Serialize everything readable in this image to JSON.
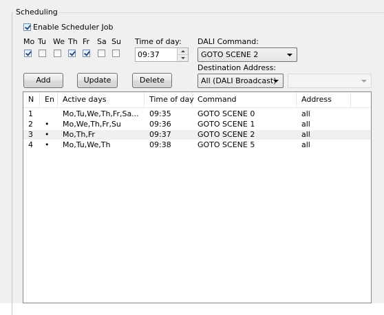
{
  "group": {
    "title": "Scheduling"
  },
  "enable": {
    "label": "Enable Scheduler Job",
    "checked": true
  },
  "days": [
    {
      "label": "Mo",
      "checked": true
    },
    {
      "label": "Tu",
      "checked": false
    },
    {
      "label": "We",
      "checked": false
    },
    {
      "label": "Th",
      "checked": true
    },
    {
      "label": "Fr",
      "checked": true
    },
    {
      "label": "Sa",
      "checked": false
    },
    {
      "label": "Su",
      "checked": false
    }
  ],
  "time_of_day": {
    "label": "Time of day:",
    "value": "09:37"
  },
  "dali_command": {
    "label": "DALI Command:",
    "value": "GOTO SCENE 2"
  },
  "destination": {
    "label": "Destination Address:",
    "value": "All (DALI Broadcast)",
    "secondary_value": ""
  },
  "buttons": {
    "add": "Add",
    "update": "Update",
    "delete": "Delete"
  },
  "table": {
    "columns": [
      "N",
      "En",
      "Active days",
      "Time of day",
      "Command",
      "Address"
    ],
    "selected_row": 2,
    "rows": [
      {
        "n": "1",
        "en": "",
        "days": "Mo,Tu,We,Th,Fr,Sa...",
        "time": "09:35",
        "command": "GOTO SCENE 0",
        "address": "all"
      },
      {
        "n": "2",
        "en": "•",
        "days": "Mo,We,Th,Fr,Su",
        "time": "09:36",
        "command": "GOTO SCENE 1",
        "address": "all"
      },
      {
        "n": "3",
        "en": "•",
        "days": "Mo,Th,Fr",
        "time": "09:37",
        "command": "GOTO SCENE 2",
        "address": "all"
      },
      {
        "n": "4",
        "en": "•",
        "days": "Mo,Tu,We,Th",
        "time": "09:38",
        "command": "GOTO SCENE 5",
        "address": "all"
      }
    ]
  }
}
